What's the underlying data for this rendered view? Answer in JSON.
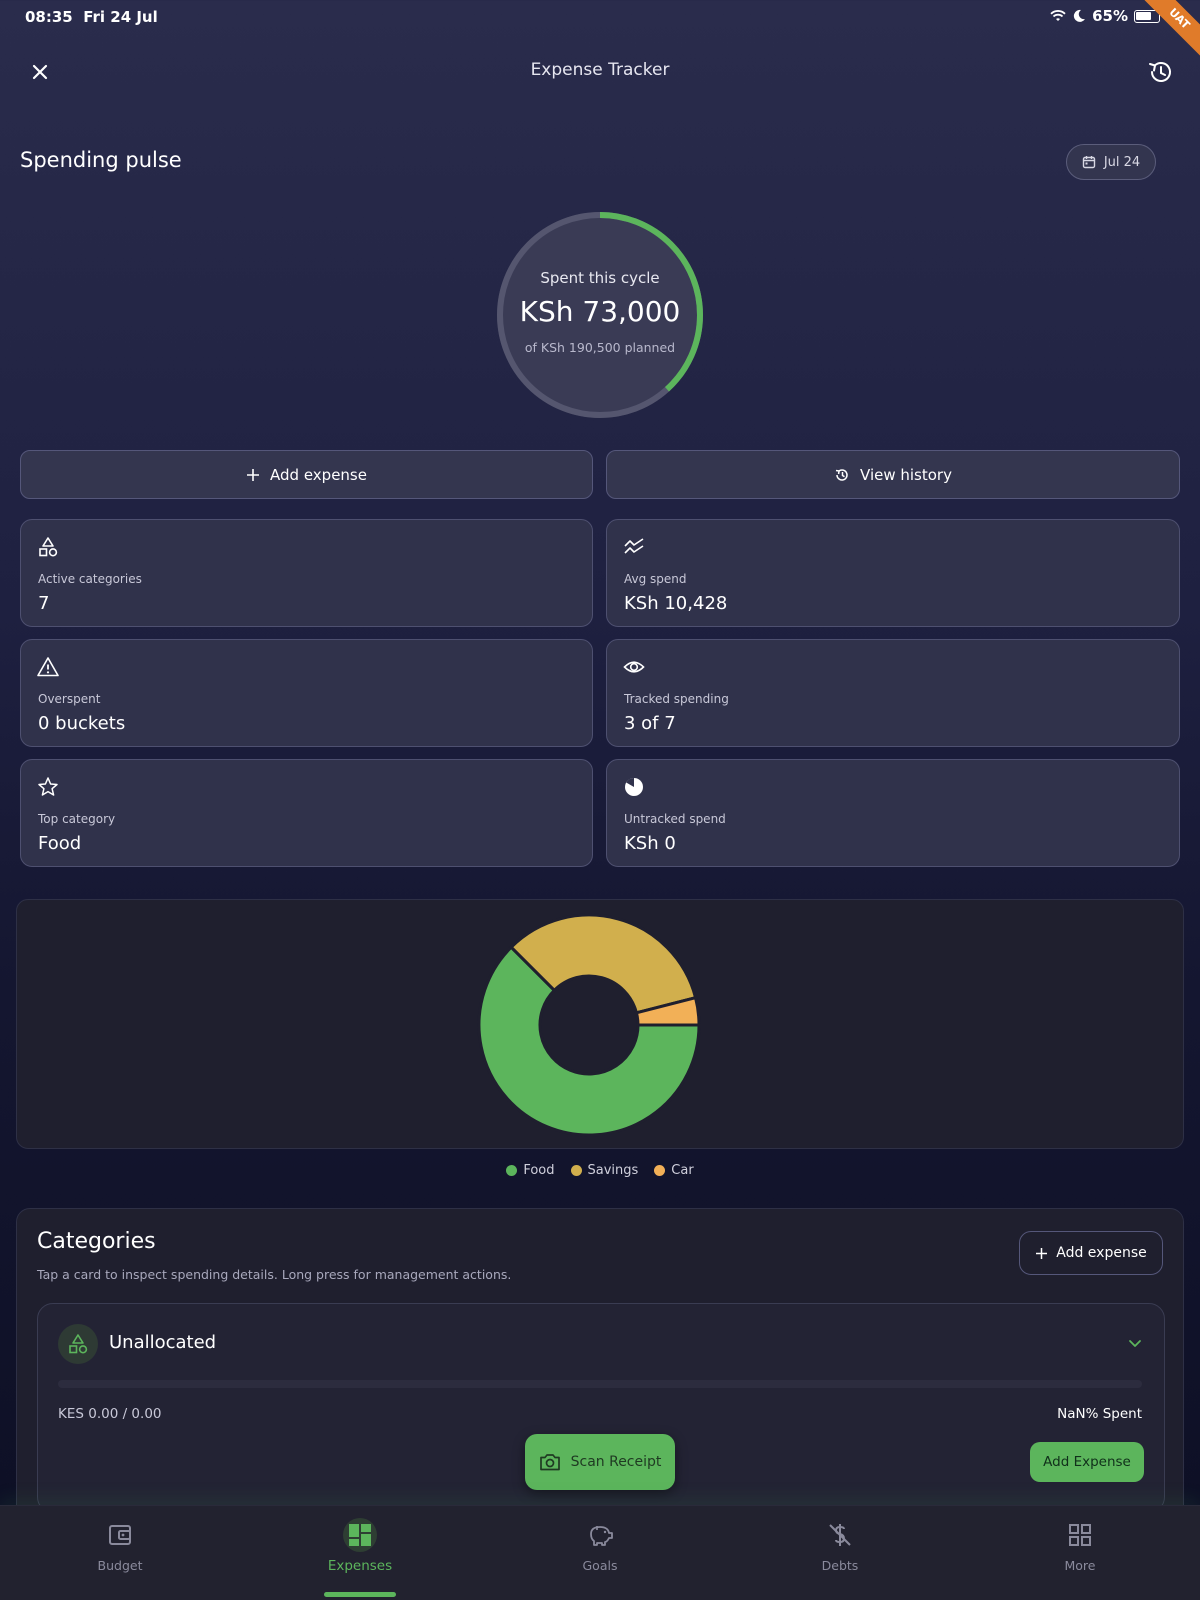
{
  "status_bar": {
    "time": "08:35",
    "date": "Fri 24 Jul",
    "battery": "65%",
    "ribbon": "UAT"
  },
  "app_bar": {
    "title": "Expense Tracker"
  },
  "pulse": {
    "title": "Spending pulse",
    "date_chip": "Jul 24",
    "ring_label": "Spent this cycle",
    "ring_amount": "KSh 73,000",
    "ring_sub": "of KSh 190,500 planned",
    "progress_fraction": 0.383,
    "accent": "#5CB55C"
  },
  "actions": {
    "add_expense": "Add expense",
    "view_history": "View history"
  },
  "stats": [
    {
      "icon": "shapes-icon",
      "label": "Active categories",
      "value": "7"
    },
    {
      "icon": "trend-icon",
      "label": "Avg spend",
      "value": "KSh 10,428"
    },
    {
      "icon": "warning-icon",
      "label": "Overspent",
      "value": "0 buckets"
    },
    {
      "icon": "eye-icon",
      "label": "Tracked spending",
      "value": "3 of 7"
    },
    {
      "icon": "star-icon",
      "label": "Top category",
      "value": "Food"
    },
    {
      "icon": "pie-icon",
      "label": "Untracked spend",
      "value": "KSh 0"
    }
  ],
  "chart_data": {
    "type": "pie",
    "categories": [
      "Food",
      "Savings",
      "Car"
    ],
    "values": [
      62.5,
      33.5,
      4.0
    ],
    "colors": [
      "#5CB55C",
      "#D1AF4D",
      "#F2B057"
    ],
    "legend": "bottom"
  },
  "categories": {
    "title": "Categories",
    "subtitle": "Tap a card to inspect spending details. Long press for management actions.",
    "add_expense": "Add expense",
    "bucket": {
      "name": "Unallocated",
      "amount": "KES 0.00 / 0.00",
      "percent": "NaN% Spent",
      "add_expense": "Add Expense"
    }
  },
  "scan_receipt": "Scan Receipt",
  "nav": [
    {
      "label": "Budget",
      "icon": "wallet-icon"
    },
    {
      "label": "Expenses",
      "icon": "dashboard-icon"
    },
    {
      "label": "Goals",
      "icon": "piggy-bank-icon"
    },
    {
      "label": "Debts",
      "icon": "money-off-icon"
    },
    {
      "label": "More",
      "icon": "grid-icon"
    }
  ]
}
